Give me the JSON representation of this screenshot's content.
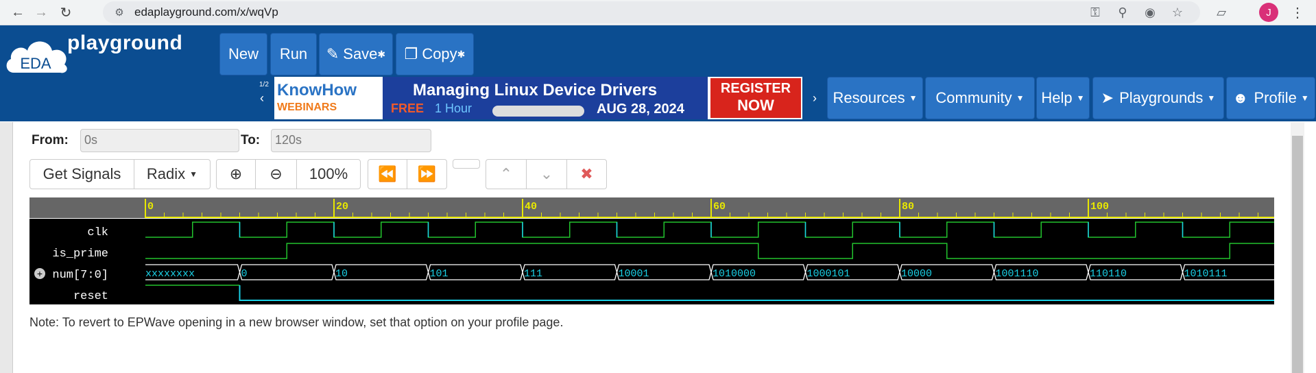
{
  "browser": {
    "url": "edaplayground.com/x/wqVp",
    "avatar_initial": "J"
  },
  "header": {
    "logo_text": "playground",
    "logo_badge": "EDA",
    "buttons": {
      "new": "New",
      "run": "Run",
      "save": "Save",
      "copy": "Copy"
    },
    "banner": {
      "index": "1/2",
      "brand_top": "KnowHow",
      "brand_bottom": "WEBINARS",
      "title": "Managing Linux Device Drivers",
      "free": "FREE",
      "hour": "1 Hour",
      "date": "AUG 28, 2024",
      "cta_top": "REGISTER",
      "cta_bottom": "NOW"
    },
    "nav": [
      "Resources",
      "Community",
      "Help",
      "Playgrounds",
      "Profile"
    ]
  },
  "controls": {
    "from_label": "From:",
    "from_value": "0s",
    "to_label": "To:",
    "to_value": "120s",
    "get_signals": "Get Signals",
    "radix": "Radix",
    "zoom": "100%"
  },
  "ruler": {
    "labels": [
      "0",
      "20",
      "40",
      "60",
      "80",
      "100"
    ]
  },
  "signals": [
    {
      "name": "clk"
    },
    {
      "name": "is_prime"
    },
    {
      "name": "num[7:0]",
      "values": [
        "xxxxxxxx",
        "0",
        "10",
        "101",
        "111",
        "10001",
        "1010000",
        "1000101",
        "10000",
        "1001110",
        "110110",
        "1010111"
      ]
    },
    {
      "name": "reset"
    }
  ],
  "note": "Note: To revert to EPWave opening in a new browser window, set that option on your profile page.",
  "colors": {
    "header": "#0b4d91",
    "button": "#2a73c4",
    "wave_green": "#22c32e",
    "wave_cyan": "#1ad1e6",
    "ruler_yellow": "#e8e800"
  }
}
